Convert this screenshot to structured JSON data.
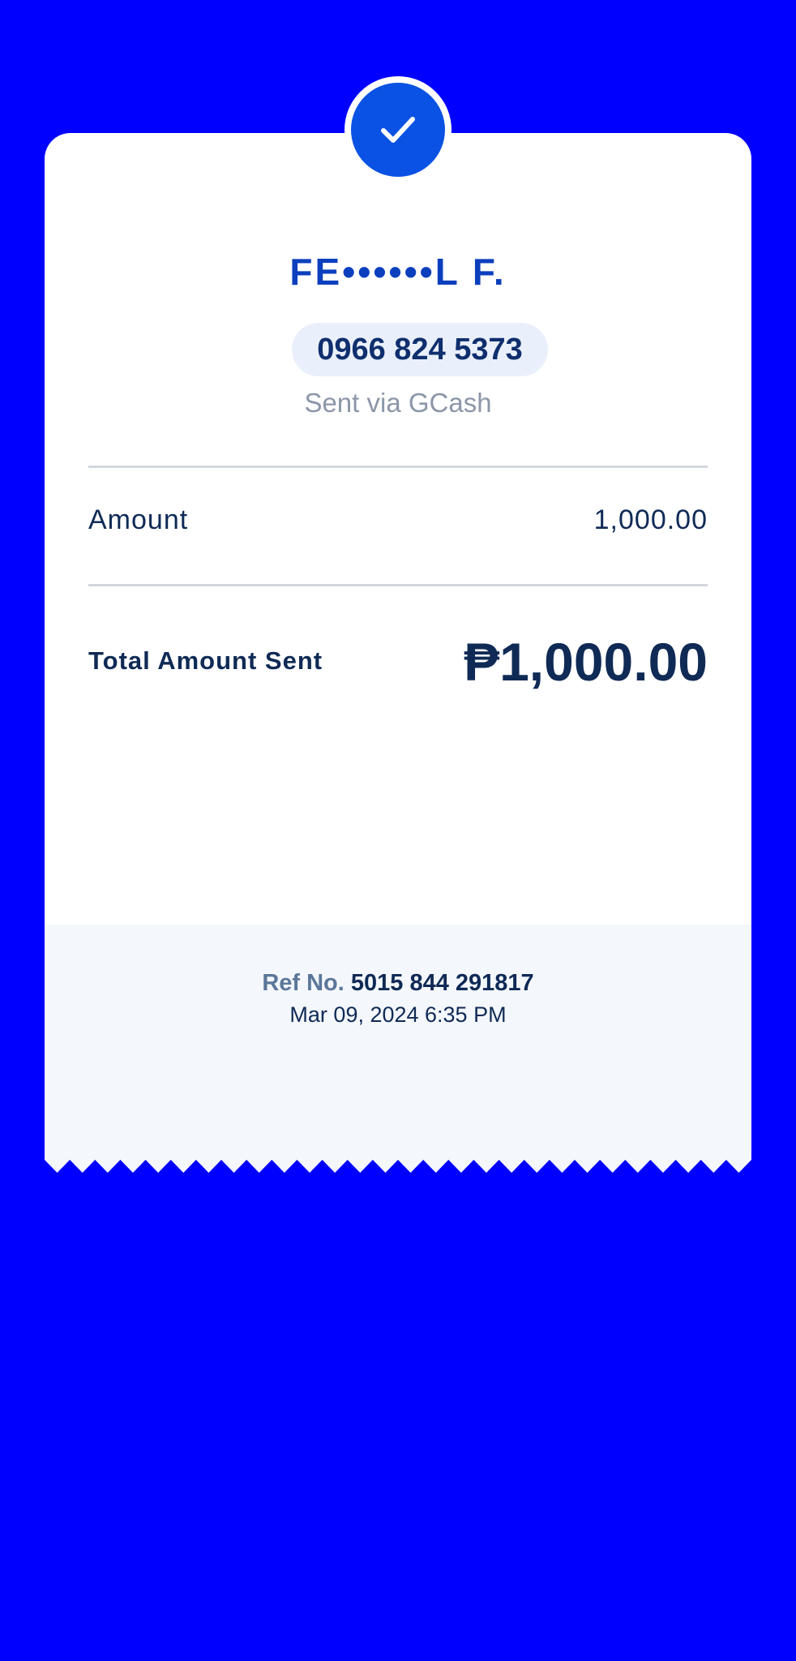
{
  "colors": {
    "background": "#0000FF",
    "accent": "#0A52E3",
    "name_blue": "#0B3FBE",
    "text_dark": "#0F2A55",
    "receipt_footer": "#F4F7FC"
  },
  "status": {
    "icon": "check-icon"
  },
  "recipient": {
    "name": "FE••••••L F.",
    "phone": "0966 824 5373",
    "sent_via": "Sent via GCash"
  },
  "breakdown": {
    "amount_label": "Amount",
    "amount_value": "1,000.00"
  },
  "total": {
    "label": "Total Amount Sent",
    "value": "₱1,000.00"
  },
  "footer": {
    "ref_label": "Ref No.",
    "ref_value": "5015 844 291817",
    "date": "Mar 09, 2024 6:35 PM"
  }
}
